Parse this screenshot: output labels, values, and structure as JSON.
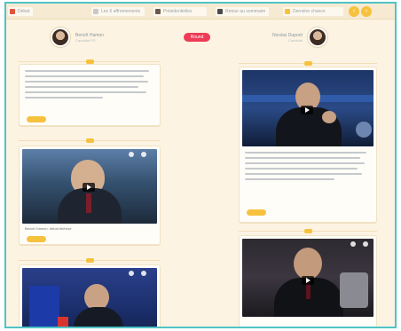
{
  "nav": {
    "items": [
      "Débat",
      "Les 6 affrontements",
      "Présidentielles",
      "Retour au sommaire",
      "Dernière chance"
    ],
    "round_buttons": [
      "‹",
      "›"
    ]
  },
  "left_author": {
    "name": "Benoît Hamon",
    "subtitle": "Candidat PS"
  },
  "right_author": {
    "name": "Nicolas Dupont",
    "subtitle": "Candidat"
  },
  "center": {
    "badge": "Round",
    "sub": ""
  },
  "left_video_caption": "Benoît Hamon: débat télévisé",
  "colors": {
    "accent": "#f6c23e",
    "badge": "#ee3b56",
    "border": "#4fc3c7",
    "background": "#fcf3e2"
  },
  "icons": [
    "flag-icon",
    "calendar-icon",
    "tv-icon",
    "gear-icon",
    "star-icon",
    "play-icon"
  ]
}
